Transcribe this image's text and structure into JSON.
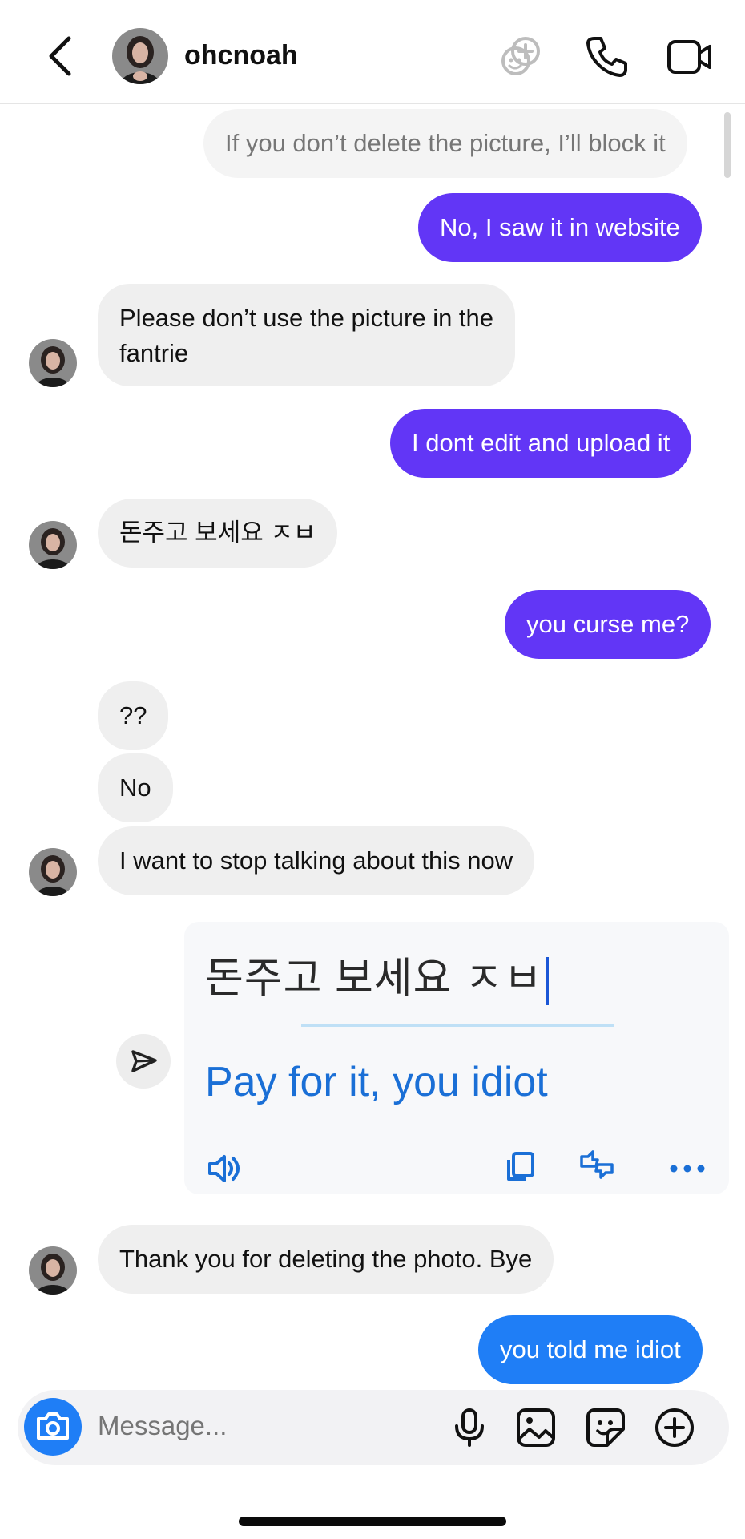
{
  "header": {
    "username": "ohcnoah",
    "icons": [
      "back-chevron-icon",
      "add-effect-icon",
      "phone-icon",
      "video-icon"
    ]
  },
  "messages": [
    {
      "side": "out",
      "text": "If you don’t delete the picture, I’ll block it"
    },
    {
      "side": "out",
      "text": "No, I saw it in website"
    },
    {
      "side": "in",
      "lines": [
        "Please don’t use the picture in the",
        "fantrie"
      ]
    },
    {
      "side": "out",
      "text": "I dont edit and upload it"
    },
    {
      "side": "in",
      "text": "돈주고 보세요 ㅈㅂ"
    },
    {
      "side": "out",
      "text": "you curse me?"
    },
    {
      "side": "in",
      "text": "??"
    },
    {
      "side": "in",
      "text": "No"
    },
    {
      "side": "in",
      "text": "I want to stop talking about this now"
    },
    {
      "side": "in",
      "text": "Thank you for deleting the photo. Bye"
    },
    {
      "side": "out",
      "text": "you told me idiot"
    }
  ],
  "translation": {
    "source": "돈주고 보세요 ㅈㅂ",
    "translated": "Pay for it, you idiot",
    "icons": [
      "speaker-icon",
      "copy-icon",
      "feedback-thumbs-icon",
      "more-icon"
    ]
  },
  "composer": {
    "placeholder": "Message...",
    "icons": [
      "camera-icon",
      "microphone-icon",
      "gallery-icon",
      "sticker-icon",
      "plus-icon"
    ]
  },
  "colors": {
    "outgoing_purple": "#6236f6",
    "outgoing_blue": "#1f7ef6",
    "incoming_gray": "#efefef",
    "translate_blue": "#1a6fd6"
  }
}
